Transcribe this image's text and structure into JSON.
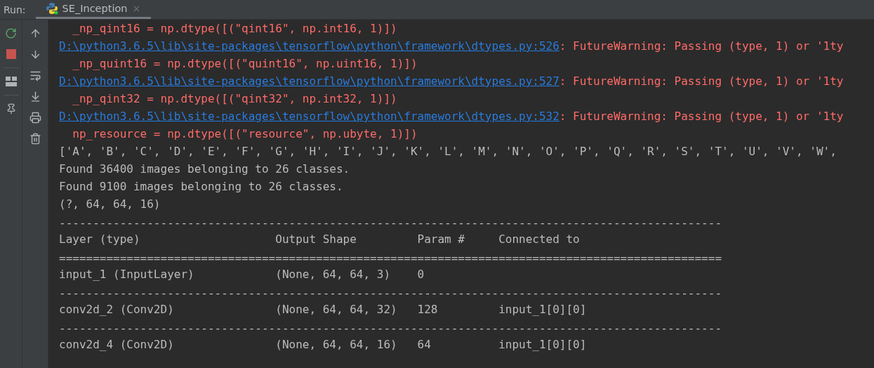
{
  "run_label": "Run:",
  "tab": {
    "title": "SE_Inception",
    "selected": true
  },
  "console": [
    {
      "kind": "error",
      "text": "  _np_qint16 = np.dtype([(\"qint16\", np.int16, 1)])"
    },
    {
      "kind": "warning",
      "link": "D:\\python3.6.5\\lib\\site-packages\\tensorflow\\python\\framework\\dtypes.py:526",
      "message": ": FutureWarning: Passing (type, 1) or '1ty"
    },
    {
      "kind": "error",
      "text": "  _np_quint16 = np.dtype([(\"quint16\", np.uint16, 1)])"
    },
    {
      "kind": "warning",
      "link": "D:\\python3.6.5\\lib\\site-packages\\tensorflow\\python\\framework\\dtypes.py:527",
      "message": ": FutureWarning: Passing (type, 1) or '1ty"
    },
    {
      "kind": "error",
      "text": "  _np_qint32 = np.dtype([(\"qint32\", np.int32, 1)])"
    },
    {
      "kind": "warning",
      "link": "D:\\python3.6.5\\lib\\site-packages\\tensorflow\\python\\framework\\dtypes.py:532",
      "message": ": FutureWarning: Passing (type, 1) or '1ty"
    },
    {
      "kind": "error",
      "text": "  np_resource = np.dtype([(\"resource\", np.ubyte, 1)])"
    },
    {
      "kind": "output",
      "text": "['A', 'B', 'C', 'D', 'E', 'F', 'G', 'H', 'I', 'J', 'K', 'L', 'M', 'N', 'O', 'P', 'Q', 'R', 'S', 'T', 'U', 'V', 'W',"
    },
    {
      "kind": "output",
      "text": "Found 36400 images belonging to 26 classes."
    },
    {
      "kind": "output",
      "text": "Found 9100 images belonging to 26 classes."
    },
    {
      "kind": "output",
      "text": "(?, 64, 64, 16)"
    },
    {
      "kind": "rule",
      "text": "--------------------------------------------------------------------------------------------------"
    },
    {
      "kind": "row",
      "cells": [
        "Layer (type)",
        "Output Shape",
        "Param #",
        "Connected to"
      ]
    },
    {
      "kind": "rule",
      "text": "=================================================================================================="
    },
    {
      "kind": "row",
      "cells": [
        "input_1 (InputLayer)",
        "(None, 64, 64, 3)",
        "0"
      ]
    },
    {
      "kind": "rule",
      "text": "--------------------------------------------------------------------------------------------------"
    },
    {
      "kind": "row",
      "cells": [
        "conv2d_2 (Conv2D)",
        "(None, 64, 64, 32)",
        "128",
        "input_1[0][0]"
      ]
    },
    {
      "kind": "rule",
      "text": "--------------------------------------------------------------------------------------------------"
    },
    {
      "kind": "row",
      "cells": [
        "conv2d_4 (Conv2D)",
        "(None, 64, 64, 16)",
        "64",
        "input_1[0][0]"
      ]
    }
  ]
}
